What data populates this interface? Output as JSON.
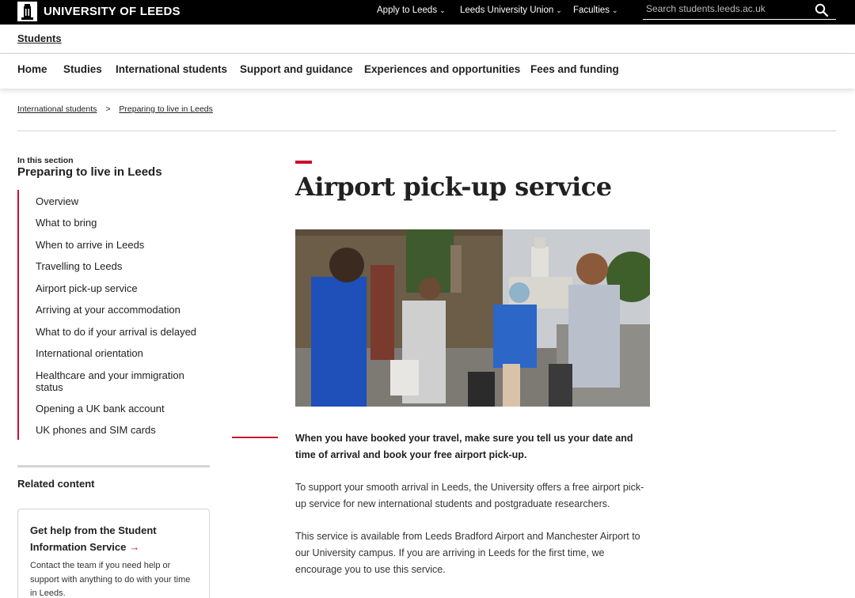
{
  "brand": {
    "name": "UNIVERSITY OF LEEDS"
  },
  "topnav": [
    {
      "label": "Apply to Leeds"
    },
    {
      "label": "Leeds University Union"
    },
    {
      "label": "Faculties"
    }
  ],
  "search": {
    "placeholder": "Search students.leeds.ac.uk"
  },
  "students_link": "Students",
  "mainnav": [
    {
      "label": "Home"
    },
    {
      "label": "Studies"
    },
    {
      "label": "International students"
    },
    {
      "label": "Support and guidance"
    },
    {
      "label": "Experiences and opportunities"
    },
    {
      "label": "Fees and funding"
    }
  ],
  "breadcrumb": [
    {
      "label": "International students"
    },
    {
      "label": "Preparing to live in Leeds"
    }
  ],
  "breadcrumb_separator": ">",
  "sidebar": {
    "section_label": "In this section",
    "section_title": "Preparing to live in Leeds",
    "items": [
      {
        "label": "Overview"
      },
      {
        "label": "What to bring"
      },
      {
        "label": "When to arrive in Leeds"
      },
      {
        "label": "Travelling to Leeds"
      },
      {
        "label": "Airport pick-up service"
      },
      {
        "label": "Arriving at your accommodation"
      },
      {
        "label": "What to do if your arrival is delayed"
      },
      {
        "label": "International orientation"
      },
      {
        "label": "Healthcare and your immigration status"
      },
      {
        "label": "Opening a UK bank account"
      },
      {
        "label": "UK phones and SIM cards"
      }
    ],
    "related_title": "Related content",
    "card": {
      "title": "Get help from the Student Information Service",
      "arrow": "→",
      "text": "Contact the team if you need help or support with anything to do with your time in Leeds."
    }
  },
  "main": {
    "title": "Airport pick-up service",
    "intro": "When you have booked your travel, make sure you tell us your date and time of arrival and book your free airport pick-up.",
    "paragraphs": [
      "To support your smooth arrival in Leeds, the University offers a free airport pick-up service for new international students and postgraduate researchers.",
      "This service is available from Leeds Bradford Airport and Manchester Airport to our University campus. If you are arriving in Leeds for the first time, we encourage you to use this service."
    ]
  },
  "colors": {
    "accent": "#c8102e",
    "topbar": "#000000"
  },
  "icons": {
    "search": "search-icon",
    "chevron": "chevron-down-icon",
    "logo": "university-crest-icon"
  }
}
